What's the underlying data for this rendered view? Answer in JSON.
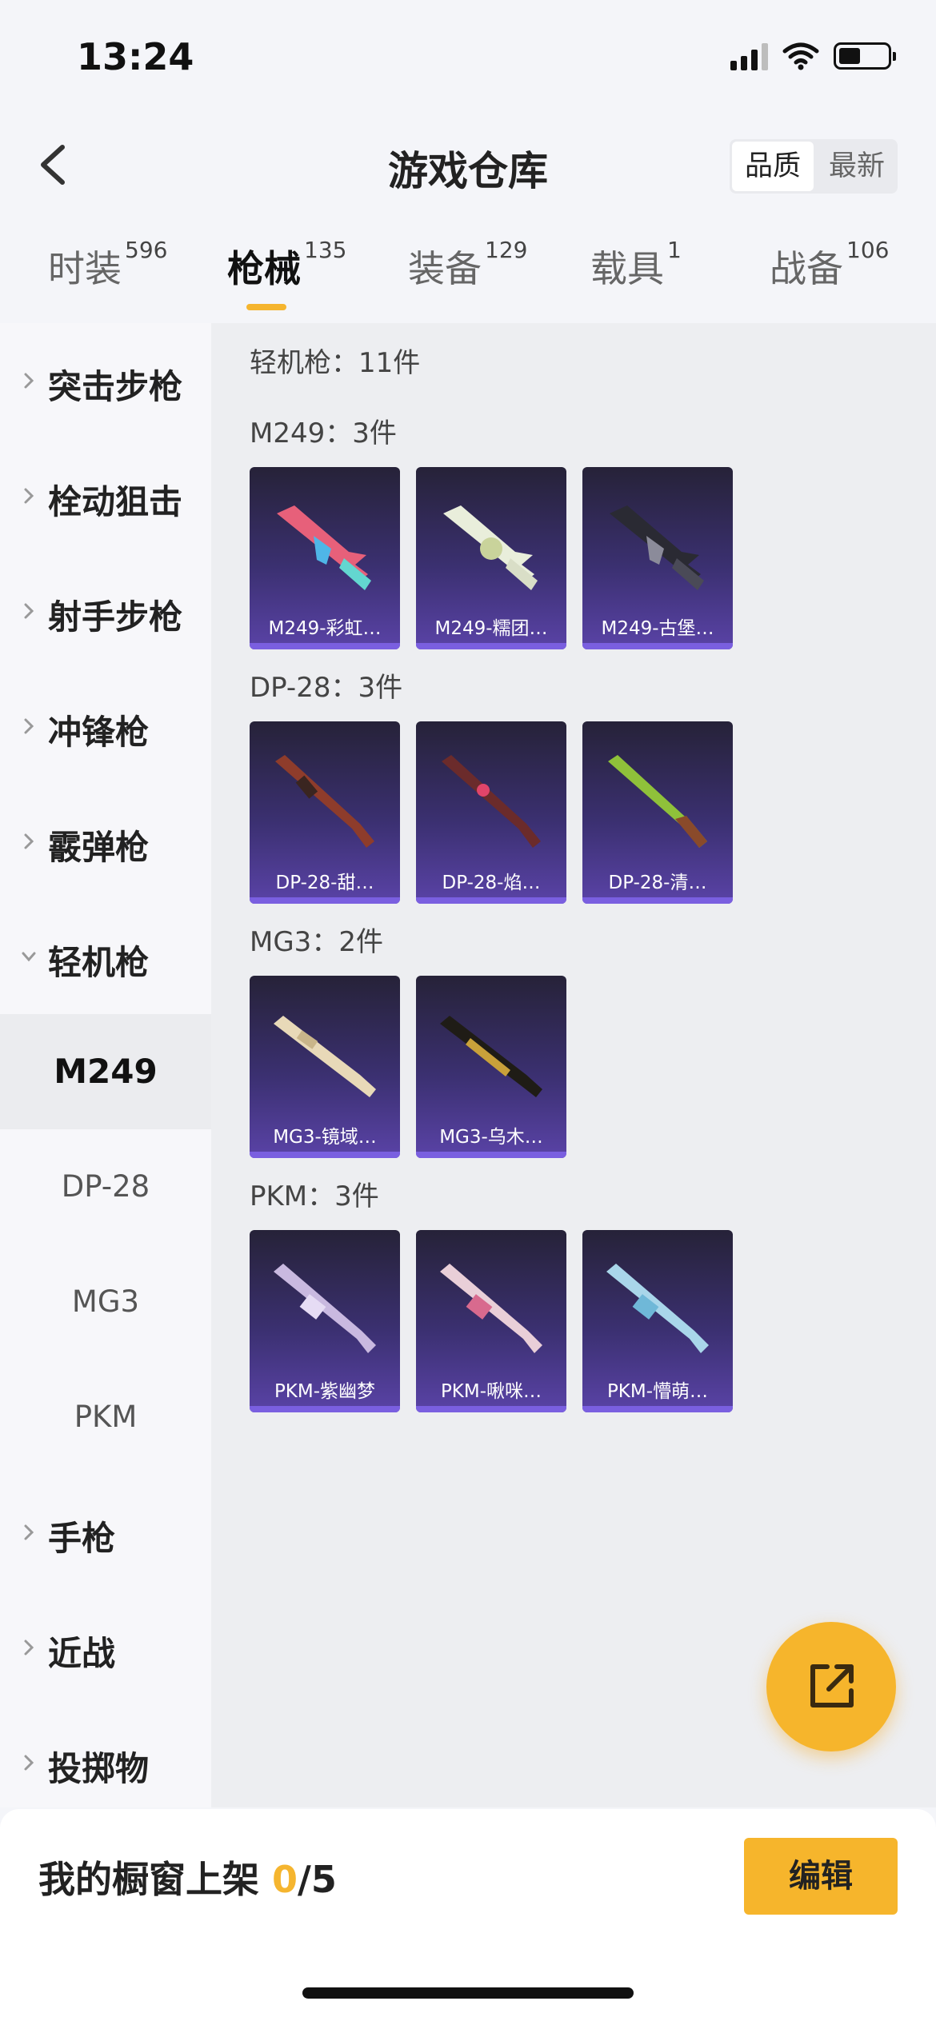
{
  "status_bar": {
    "time": "13:24"
  },
  "header": {
    "title": "游戏仓库",
    "sort_options": [
      "品质",
      "最新"
    ]
  },
  "tabs": [
    {
      "label": "时装",
      "count": "596"
    },
    {
      "label": "枪械",
      "count": "135"
    },
    {
      "label": "装备",
      "count": "129"
    },
    {
      "label": "载具",
      "count": "1"
    },
    {
      "label": "战备",
      "count": "106"
    }
  ],
  "sidebar": {
    "categories": [
      "突击步枪",
      "栓动狙击",
      "射手步枪",
      "冲锋枪",
      "霰弹枪",
      "轻机枪"
    ],
    "subcategories": [
      "M249",
      "DP-28",
      "MG3",
      "PKM"
    ],
    "more_categories": [
      "手枪",
      "近战",
      "投掷物"
    ]
  },
  "main": {
    "total": "轻机枪：11件",
    "groups": [
      {
        "heading": "M249：3件",
        "items": [
          "M249-彩虹…",
          "M249-糯团…",
          "M249-古堡…"
        ]
      },
      {
        "heading": "DP-28：3件",
        "items": [
          "DP-28-甜…",
          "DP-28-焰…",
          "DP-28-清…"
        ]
      },
      {
        "heading": "MG3：2件",
        "items": [
          "MG3-镜域…",
          "MG3-乌木…"
        ]
      },
      {
        "heading": "PKM：3件",
        "items": [
          "PKM-紫幽梦",
          "PKM-啾咪…",
          "PKM-懵萌…"
        ]
      }
    ]
  },
  "bottom_bar": {
    "label": "我的橱窗上架 ",
    "count": "0",
    "total": "/5",
    "edit_label": "编辑"
  },
  "colors": {
    "accent": "#f6b52c",
    "card_top": "#262238",
    "card_bottom": "#5a43a7"
  },
  "icons": {
    "back": "chevron-left-icon",
    "share": "share-external-icon"
  }
}
